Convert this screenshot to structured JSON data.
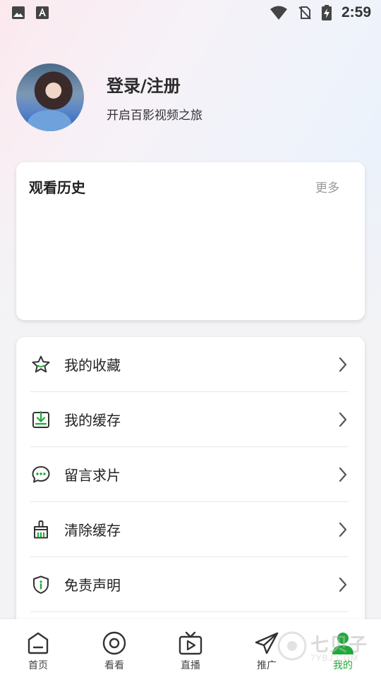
{
  "status_bar": {
    "time": "2:59",
    "left_icons": [
      "image-icon",
      "text-a-icon"
    ],
    "right_icons": [
      "wifi-icon",
      "no-sim-icon",
      "battery-charging-icon"
    ]
  },
  "profile": {
    "title": "登录/注册",
    "subtitle": "开启百影视频之旅"
  },
  "history": {
    "title": "观看历史",
    "more": "更多"
  },
  "menu": {
    "items": [
      {
        "label": "我的收藏",
        "icon": "star-icon"
      },
      {
        "label": "我的缓存",
        "icon": "download-icon"
      },
      {
        "label": "留言求片",
        "icon": "chat-icon"
      },
      {
        "label": "清除缓存",
        "icon": "broom-icon"
      },
      {
        "label": "免责声明",
        "icon": "shield-icon"
      }
    ]
  },
  "tabbar": {
    "tabs": [
      {
        "label": "首页",
        "icon": "home-icon"
      },
      {
        "label": "看看",
        "icon": "target-icon"
      },
      {
        "label": "直播",
        "icon": "tv-icon"
      },
      {
        "label": "推广",
        "icon": "paper-plane-icon"
      },
      {
        "label": "我的",
        "icon": "user-icon",
        "active": true
      }
    ]
  },
  "watermark": {
    "text": "七贝子",
    "sub": "7YBJ.COM"
  },
  "colors": {
    "accent": "#1eaa3a",
    "icon_stroke": "#333333",
    "chevron": "#555555"
  }
}
